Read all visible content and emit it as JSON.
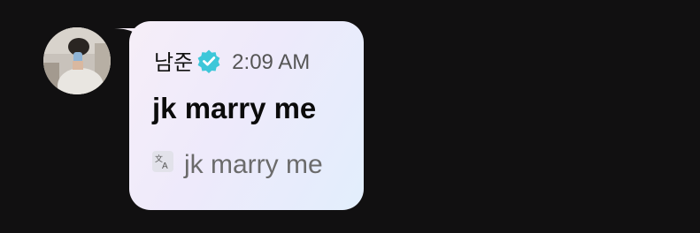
{
  "message": {
    "sender_name": "남준",
    "verified_icon": "verified-badge-icon",
    "timestamp": "2:09 AM",
    "text": "jk marry me",
    "translation_icon": "translate-icon",
    "translation_text": "jk marry me"
  },
  "colors": {
    "background": "#111011",
    "bubble_gradient_start": "#f6eef8",
    "bubble_gradient_end": "#e2eefc",
    "verified": "#3dc7d9",
    "timestamp": "#555555",
    "translation_text": "#6b6b6b"
  }
}
